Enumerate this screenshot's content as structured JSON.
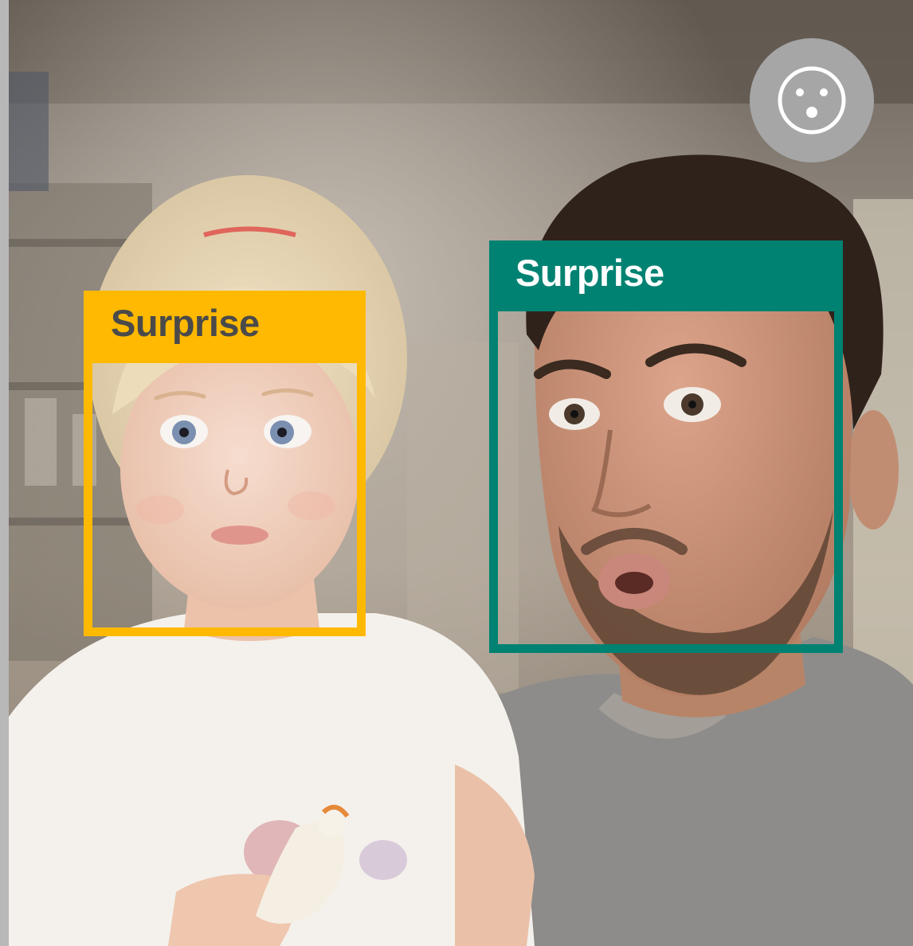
{
  "detections": [
    {
      "emotion": "Surprise",
      "color": "#ffb900",
      "label_text_color": "#4a4a4a"
    },
    {
      "emotion": "Surprise",
      "color": "#008272",
      "label_text_color": "#ffffff"
    }
  ],
  "emotion_button": {
    "icon": "surprised-face-icon",
    "color": "#a6a6a6"
  }
}
